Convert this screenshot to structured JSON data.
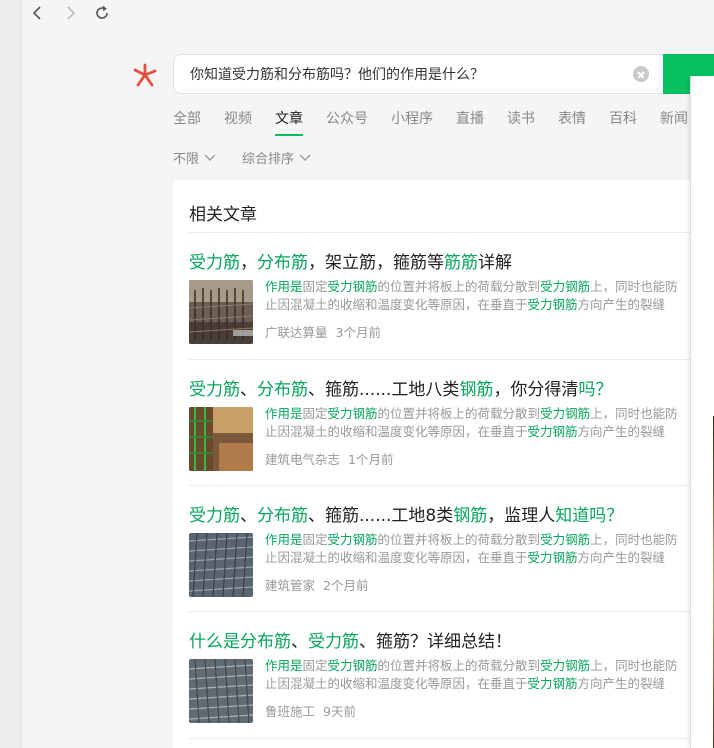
{
  "navigation": {
    "back_icon": "back-arrow-icon",
    "forward_icon": "forward-arrow-icon",
    "reload_icon": "reload-icon"
  },
  "search": {
    "query": "你知道受力筋和分布筋吗？他们的作用是什么？",
    "clear_icon": "clear-circle-icon"
  },
  "colors": {
    "accent": "#07c160",
    "highlight": "#07a55d",
    "logo": "#e84c3d"
  },
  "tabs": [
    {
      "label": "全部",
      "active": false
    },
    {
      "label": "视频",
      "active": false
    },
    {
      "label": "文章",
      "active": true
    },
    {
      "label": "公众号",
      "active": false
    },
    {
      "label": "小程序",
      "active": false
    },
    {
      "label": "直播",
      "active": false
    },
    {
      "label": "读书",
      "active": false
    },
    {
      "label": "表情",
      "active": false
    },
    {
      "label": "百科",
      "active": false
    },
    {
      "label": "新闻",
      "active": false
    }
  ],
  "filters": [
    {
      "label": "不限"
    },
    {
      "label": "综合排序"
    }
  ],
  "results": {
    "section_title": "相关文章",
    "articles": [
      {
        "title": [
          {
            "t": "受力筋",
            "hl": true
          },
          {
            "t": "，",
            "hl": false
          },
          {
            "t": "分布筋",
            "hl": true
          },
          {
            "t": "，架立筋，箍筋等",
            "hl": false
          },
          {
            "t": "筋筋",
            "hl": true
          },
          {
            "t": "详解",
            "hl": false
          }
        ],
        "snippet1": [
          {
            "t": "作用是",
            "hl": true
          },
          {
            "t": "固定",
            "hl": false
          },
          {
            "t": "受力钢筋",
            "hl": true
          },
          {
            "t": "的位置并将板上的荷载分散到",
            "hl": false
          },
          {
            "t": "受力钢筋",
            "hl": true
          },
          {
            "t": "上，同时也能防",
            "hl": false
          }
        ],
        "snippet2": [
          {
            "t": "止因混凝土的收缩和温度变化等原因，在垂直于",
            "hl": false
          },
          {
            "t": "受力钢筋",
            "hl": true
          },
          {
            "t": "方向产生的裂缝",
            "hl": false
          }
        ],
        "source": "广联达算量",
        "time": "3个月前"
      },
      {
        "title": [
          {
            "t": "受力筋",
            "hl": true
          },
          {
            "t": "、",
            "hl": false
          },
          {
            "t": "分布筋",
            "hl": true
          },
          {
            "t": "、箍筋......工地八类",
            "hl": false
          },
          {
            "t": "钢筋",
            "hl": true
          },
          {
            "t": "，你分得清",
            "hl": false
          },
          {
            "t": "吗？",
            "hl": true
          }
        ],
        "snippet1": [
          {
            "t": "作用是",
            "hl": true
          },
          {
            "t": "固定",
            "hl": false
          },
          {
            "t": "受力钢筋",
            "hl": true
          },
          {
            "t": "的位置并将板上的荷载分散到",
            "hl": false
          },
          {
            "t": "受力钢筋",
            "hl": true
          },
          {
            "t": "上，同时也能防",
            "hl": false
          }
        ],
        "snippet2": [
          {
            "t": "止因混凝土的收缩和温度变化等原因，在垂直于",
            "hl": false
          },
          {
            "t": "受力钢筋",
            "hl": true
          },
          {
            "t": "方向产生的裂缝",
            "hl": false
          }
        ],
        "source": "建筑电气杂志",
        "time": "1个月前"
      },
      {
        "title": [
          {
            "t": "受力筋",
            "hl": true
          },
          {
            "t": "、",
            "hl": false
          },
          {
            "t": "分布筋",
            "hl": true
          },
          {
            "t": "、箍筋......工地8类",
            "hl": false
          },
          {
            "t": "钢筋",
            "hl": true
          },
          {
            "t": "，监理人",
            "hl": false
          },
          {
            "t": "知道吗？",
            "hl": true
          }
        ],
        "snippet1": [
          {
            "t": "作用是",
            "hl": true
          },
          {
            "t": "固定",
            "hl": false
          },
          {
            "t": "受力钢筋",
            "hl": true
          },
          {
            "t": "的位置并将板上的荷载分散到",
            "hl": false
          },
          {
            "t": "受力钢筋",
            "hl": true
          },
          {
            "t": "上，同时也能防",
            "hl": false
          }
        ],
        "snippet2": [
          {
            "t": "止因混凝土的收缩和温度变化等原因，在垂直于",
            "hl": false
          },
          {
            "t": "受力钢筋",
            "hl": true
          },
          {
            "t": "方向产生的裂缝",
            "hl": false
          }
        ],
        "source": "建筑管家",
        "time": "2个月前"
      },
      {
        "title": [
          {
            "t": "什么是分布筋",
            "hl": true
          },
          {
            "t": "、",
            "hl": false
          },
          {
            "t": "受力筋",
            "hl": true
          },
          {
            "t": "、箍筋？详细总结！",
            "hl": false
          }
        ],
        "snippet1": [
          {
            "t": "作用是",
            "hl": true
          },
          {
            "t": "固定",
            "hl": false
          },
          {
            "t": "受力钢筋",
            "hl": true
          },
          {
            "t": "的位置并将板上的荷载分散到",
            "hl": false
          },
          {
            "t": "受力钢筋",
            "hl": true
          },
          {
            "t": "上，同时也能防",
            "hl": false
          }
        ],
        "snippet2": [
          {
            "t": "止因混凝土的收缩和温度变化等原因，在垂直于",
            "hl": false
          },
          {
            "t": "受力钢筋",
            "hl": true
          },
          {
            "t": "方向产生的裂缝",
            "hl": false
          }
        ],
        "source": "鲁班施工",
        "time": "9天前"
      }
    ]
  }
}
